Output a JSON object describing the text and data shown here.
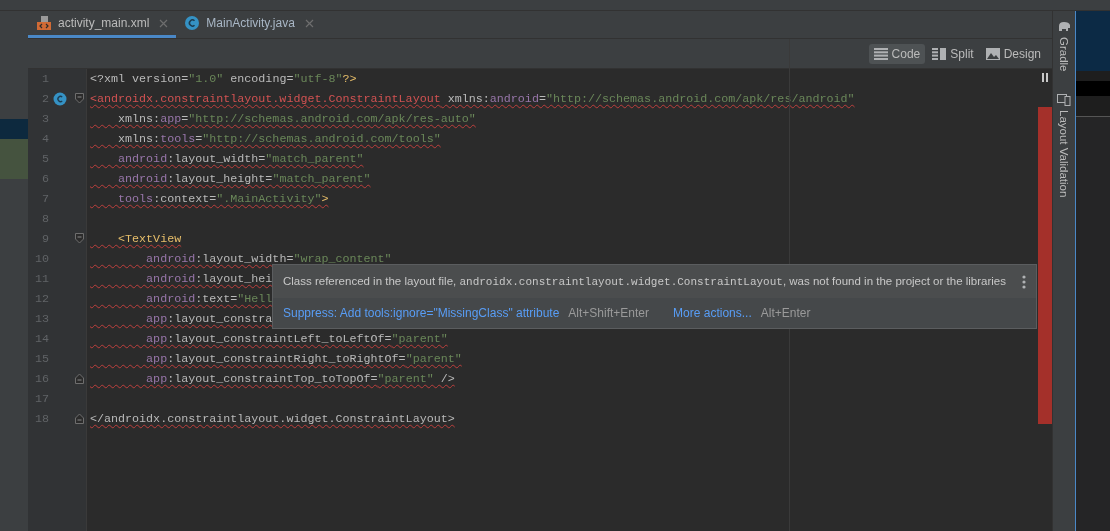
{
  "tabs": [
    {
      "label": "activity_main.xml",
      "kind": "xml",
      "selected": true
    },
    {
      "label": "MainActivity.java",
      "kind": "java",
      "selected": false
    }
  ],
  "view_modes": [
    {
      "label": "Code",
      "kind": "code",
      "selected": true
    },
    {
      "label": "Split",
      "kind": "split",
      "selected": false
    },
    {
      "label": "Design",
      "kind": "design",
      "selected": false
    }
  ],
  "editor": {
    "lines": [
      {
        "number": "1",
        "error": false,
        "tokens": [
          {
            "kind": "text",
            "text": "<?xml version="
          },
          {
            "kind": "string",
            "text": "\"1.0\""
          },
          {
            "kind": "text",
            "text": " encoding="
          },
          {
            "kind": "string",
            "text": "\"utf-8\""
          },
          {
            "kind": "tag",
            "text": "?>"
          }
        ]
      },
      {
        "number": "2",
        "error": true,
        "fold_open": true,
        "class_marker": true,
        "tokens": [
          {
            "kind": "tag_error",
            "text": "<androidx.constraintlayout.widget.ConstraintLayout"
          },
          {
            "kind": "text",
            "text": " xmlns:"
          },
          {
            "kind": "ns",
            "text": "android"
          },
          {
            "kind": "text",
            "text": "="
          },
          {
            "kind": "string",
            "text": "\"http://schemas.android.com/apk/res/android\""
          }
        ]
      },
      {
        "number": "3",
        "error": true,
        "tokens": [
          {
            "kind": "text",
            "text": "    xmlns:"
          },
          {
            "kind": "ns",
            "text": "app"
          },
          {
            "kind": "text",
            "text": "="
          },
          {
            "kind": "string",
            "text": "\"http://schemas.android.com/apk/res-auto\""
          }
        ]
      },
      {
        "number": "4",
        "error": true,
        "tokens": [
          {
            "kind": "text",
            "text": "    xmlns:"
          },
          {
            "kind": "ns",
            "text": "tools"
          },
          {
            "kind": "text",
            "text": "="
          },
          {
            "kind": "string",
            "text": "\"http://schemas.android.com/tools\""
          }
        ]
      },
      {
        "number": "5",
        "error": true,
        "tokens": [
          {
            "kind": "ns",
            "text": "    android"
          },
          {
            "kind": "text",
            "text": ":layout_width="
          },
          {
            "kind": "string",
            "text": "\"match_parent\""
          }
        ]
      },
      {
        "number": "6",
        "error": true,
        "tokens": [
          {
            "kind": "ns",
            "text": "    android"
          },
          {
            "kind": "text",
            "text": ":layout_height="
          },
          {
            "kind": "string",
            "text": "\"match_parent\""
          }
        ]
      },
      {
        "number": "7",
        "error": true,
        "tokens": [
          {
            "kind": "ns",
            "text": "    tools"
          },
          {
            "kind": "text",
            "text": ":context="
          },
          {
            "kind": "string",
            "text": "\".MainActivity\""
          },
          {
            "kind": "tag",
            "text": ">"
          }
        ]
      },
      {
        "number": "8"
      },
      {
        "number": "9",
        "error": true,
        "fold_open": true,
        "tokens": [
          {
            "kind": "tag",
            "text": "    <TextView"
          }
        ]
      },
      {
        "number": "10",
        "error": true,
        "tokens": [
          {
            "kind": "ns",
            "text": "        android"
          },
          {
            "kind": "text",
            "text": ":layout_width="
          },
          {
            "kind": "string",
            "text": "\"wrap_content\""
          }
        ]
      },
      {
        "number": "11",
        "error": true,
        "tokens": [
          {
            "kind": "ns",
            "text": "        android"
          },
          {
            "kind": "text",
            "text": ":layout_hei"
          }
        ]
      },
      {
        "number": "12",
        "error": true,
        "tokens": [
          {
            "kind": "ns",
            "text": "        android"
          },
          {
            "kind": "text",
            "text": ":text="
          },
          {
            "kind": "string",
            "text": "\"Hell"
          }
        ]
      },
      {
        "number": "13",
        "error": true,
        "tokens": [
          {
            "kind": "ns",
            "text": "        app"
          },
          {
            "kind": "text",
            "text": ":layout_constra"
          }
        ]
      },
      {
        "number": "14",
        "error": true,
        "tokens": [
          {
            "kind": "ns",
            "text": "        app"
          },
          {
            "kind": "text",
            "text": ":layout_constraintLeft_toLeftOf="
          },
          {
            "kind": "string",
            "text": "\"parent\""
          }
        ]
      },
      {
        "number": "15",
        "error": true,
        "tokens": [
          {
            "kind": "ns",
            "text": "        app"
          },
          {
            "kind": "text",
            "text": ":layout_constraintRight_toRightOf="
          },
          {
            "kind": "string",
            "text": "\"parent\""
          }
        ]
      },
      {
        "number": "16",
        "error": true,
        "fold_close": true,
        "tokens": [
          {
            "kind": "ns",
            "text": "        app"
          },
          {
            "kind": "text",
            "text": ":layout_constraintTop_toTopOf="
          },
          {
            "kind": "string",
            "text": "\"parent\""
          },
          {
            "kind": "text",
            "text": " />"
          }
        ]
      },
      {
        "number": "17"
      },
      {
        "number": "18",
        "error": true,
        "fold_close": true,
        "tokens": [
          {
            "kind": "text",
            "text": "</androidx.constraintlayout.widget.ConstraintLayout>"
          }
        ]
      }
    ]
  },
  "popup": {
    "message_before": "Class referenced in the layout file, ",
    "message_code": "androidx.constraintlayout.widget.ConstraintLayout",
    "message_after": ", was not found in the project or the libraries",
    "actions": [
      {
        "label": "Suppress: Add tools:ignore=\"MissingClass\" attribute",
        "shortcut": "Alt+Shift+Enter"
      },
      {
        "label": "More actions...",
        "shortcut": "Alt+Enter"
      }
    ]
  },
  "tool_windows": [
    {
      "label": "Gradle",
      "kind": "gradle"
    },
    {
      "label": "Layout Validation",
      "kind": "layout"
    }
  ]
}
